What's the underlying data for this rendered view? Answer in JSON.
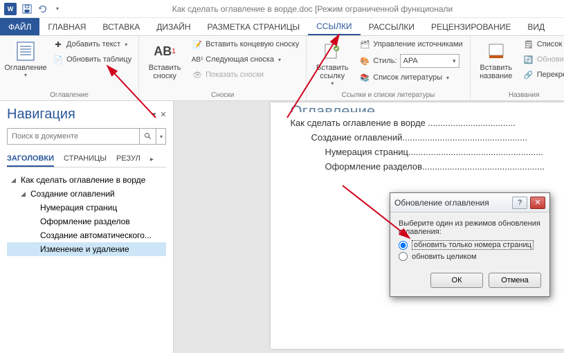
{
  "title": "Как сделать оглавление в ворде.doc [Режим ограниченной функционали",
  "tabs": {
    "file": "ФАЙЛ",
    "home": "ГЛАВНАЯ",
    "insert": "ВСТАВКА",
    "design": "ДИЗАЙН",
    "layout": "РАЗМЕТКА СТРАНИЦЫ",
    "references": "ССЫЛКИ",
    "mailings": "РАССЫЛКИ",
    "review": "РЕЦЕНЗИРОВАНИЕ",
    "view": "ВИД"
  },
  "ribbon": {
    "toc_group": {
      "big": "Оглавление",
      "add_text": "Добавить текст",
      "update": "Обновить таблицу",
      "label": "Оглавление"
    },
    "footnotes": {
      "big": "Вставить\nсноску",
      "ab": "AB",
      "insert_end": "Вставить концевую сноску",
      "next": "Следующая сноска",
      "show": "Показать сноски",
      "label": "Сноски"
    },
    "citations": {
      "big": "Вставить\nссылку",
      "manage": "Управление источниками",
      "style": "Стиль:",
      "style_val": "APA",
      "biblio": "Список литературы",
      "label": "Ссылки и списки литературы"
    },
    "captions": {
      "big": "Вставить\nназвание",
      "list": "Список и",
      "update": "Обновит",
      "cross": "Перекрес",
      "label": "Названия"
    }
  },
  "nav": {
    "title": "Навигация",
    "search_placeholder": "Поиск в документе",
    "tabs": {
      "headings": "ЗАГОЛОВКИ",
      "pages": "СТРАНИЦЫ",
      "results": "РЕЗУЛ"
    },
    "tree": [
      {
        "label": "Как сделать оглавление в ворде",
        "level": 1
      },
      {
        "label": "Создание оглавлений",
        "level": 2
      },
      {
        "label": "Нумерация страниц",
        "level": 3
      },
      {
        "label": "Оформление разделов",
        "level": 3
      },
      {
        "label": "Создание автоматического...",
        "level": 3
      },
      {
        "label": "Изменение и удаление",
        "level": 3,
        "selected": true
      }
    ]
  },
  "doc": {
    "heading": "Оглавление",
    "toc": [
      "Как сделать оглавление в ворде ...................................",
      "Создание оглавлений..................................................",
      "Нумерация страниц......................................................",
      "Оформление разделов................................................."
    ]
  },
  "dialog": {
    "title": "Обновление оглавления",
    "prompt": "Выберите один из режимов обновления оглавления:",
    "opt1": "обновить только номера страниц",
    "opt2": "обновить целиком",
    "ok": "ОК",
    "cancel": "Отмена"
  }
}
